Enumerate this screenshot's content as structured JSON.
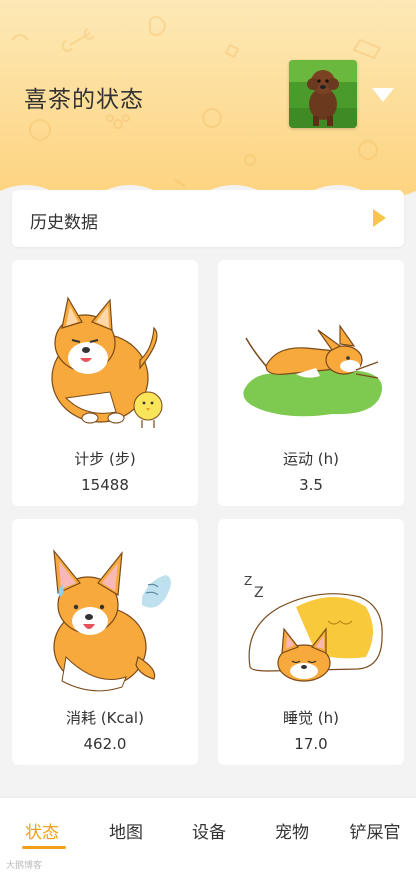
{
  "header": {
    "title": "喜茶的状态",
    "avatar_icon": "dog-avatar-icon",
    "dropdown_icon": "triangle-down-icon"
  },
  "history": {
    "label": "历史数据",
    "arrow_icon": "triangle-right-icon"
  },
  "cards": [
    {
      "name": "计步 (步)",
      "value": "15488",
      "illustration": "corgi-with-chick"
    },
    {
      "name": "运动 (h)",
      "value": "3.5",
      "illustration": "chihuahua-running"
    },
    {
      "name": "消耗 (Kcal)",
      "value": "462.0",
      "illustration": "corgi-sweating"
    },
    {
      "name": "睡觉 (h)",
      "value": "17.0",
      "illustration": "corgi-sleeping"
    }
  ],
  "tabs": [
    {
      "label": "状态",
      "active": true
    },
    {
      "label": "地图",
      "active": false
    },
    {
      "label": "设备",
      "active": false
    },
    {
      "label": "宠物",
      "active": false
    },
    {
      "label": "铲屎官",
      "active": false
    }
  ],
  "watermark": "大鹅博客",
  "colors": {
    "accent": "#f0a01a",
    "header_top": "#fde9b6",
    "header_bottom": "#fdd37f",
    "background": "#f3f3f3"
  }
}
